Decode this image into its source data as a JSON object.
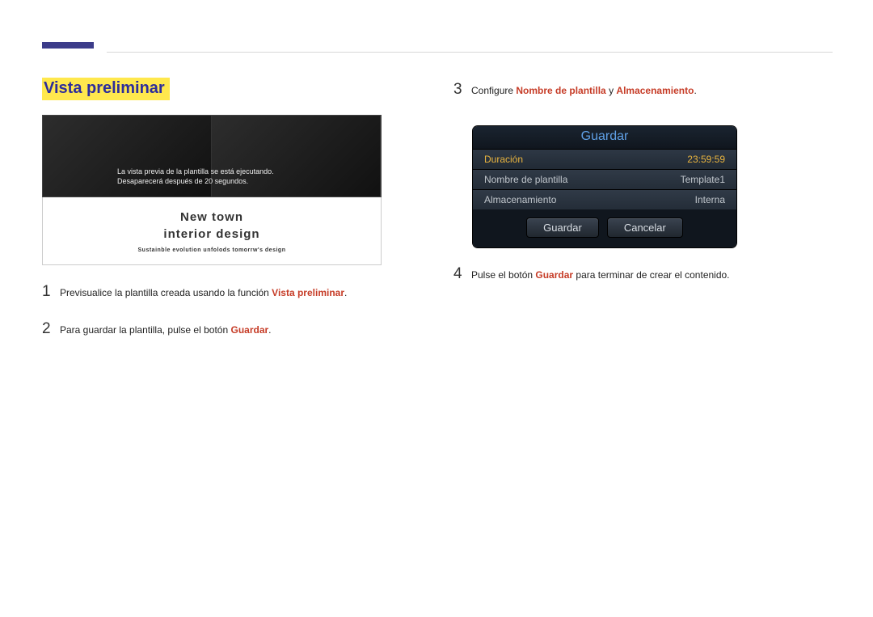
{
  "section_title": "Vista preliminar",
  "preview": {
    "overlay_line1": "La vista previa de la plantilla se está ejecutando.",
    "overlay_line2": "Desaparecerá después de 20 segundos.",
    "caption_line1": "New town",
    "caption_line2": "interior design",
    "caption_sub": "Sustainble evolution unfolods tomorrw's design"
  },
  "steps": {
    "s1": {
      "num": "1",
      "a": "Previsualice la plantilla creada usando la función ",
      "em": "Vista preliminar",
      "b": "."
    },
    "s2": {
      "num": "2",
      "a": "Para guardar la plantilla, pulse el botón ",
      "em": "Guardar",
      "b": "."
    },
    "s3": {
      "num": "3",
      "a": "Configure ",
      "em1": "Nombre de plantilla",
      "mid": " y ",
      "em2": "Almacenamiento",
      "b": "."
    },
    "s4": {
      "num": "4",
      "a": "Pulse el botón ",
      "em": "Guardar",
      "b": " para terminar de crear el contenido."
    }
  },
  "dialog": {
    "title": "Guardar",
    "rows": {
      "r1": {
        "label": "Duración",
        "value": "23:59:59"
      },
      "r2": {
        "label": "Nombre de plantilla",
        "value": "Template1"
      },
      "r3": {
        "label": "Almacenamiento",
        "value": "Interna"
      }
    },
    "btn_save": "Guardar",
    "btn_cancel": "Cancelar"
  }
}
